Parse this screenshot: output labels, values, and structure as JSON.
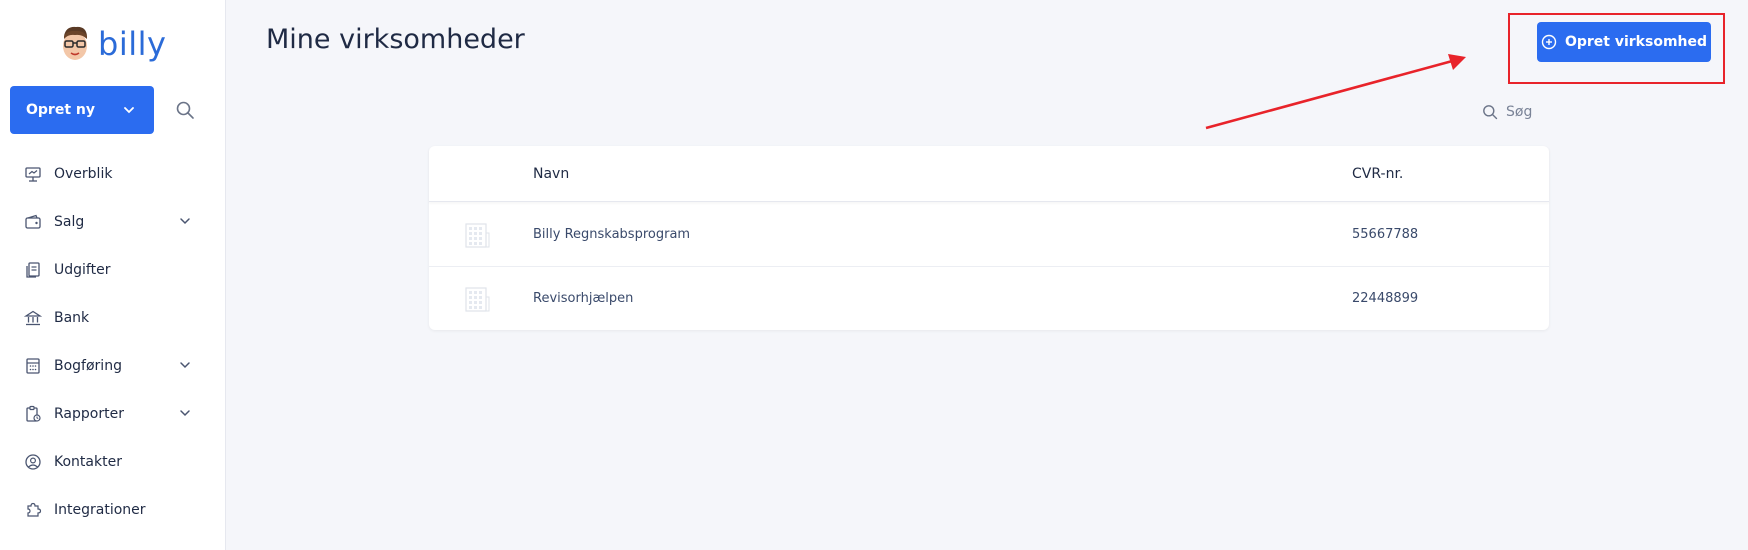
{
  "sidebar": {
    "logo_text": "billy",
    "create_button": "Opret ny",
    "items": [
      {
        "label": "Overblik",
        "icon": "presentation-icon",
        "has_chevron": false
      },
      {
        "label": "Salg",
        "icon": "wallet-icon",
        "has_chevron": true
      },
      {
        "label": "Udgifter",
        "icon": "receipts-icon",
        "has_chevron": false
      },
      {
        "label": "Bank",
        "icon": "bank-icon",
        "has_chevron": false
      },
      {
        "label": "Bogføring",
        "icon": "calculator-icon",
        "has_chevron": true
      },
      {
        "label": "Rapporter",
        "icon": "report-icon",
        "has_chevron": true
      },
      {
        "label": "Kontakter",
        "icon": "user-circle-icon",
        "has_chevron": false
      },
      {
        "label": "Integrationer",
        "icon": "puzzle-icon",
        "has_chevron": false
      }
    ]
  },
  "main": {
    "title": "Mine virksomheder",
    "create_company_button": "Opret virksomhed",
    "search_placeholder": "Søg",
    "table": {
      "headers": {
        "name": "Navn",
        "cvr": "CVR-nr."
      },
      "rows": [
        {
          "name": "Billy Regnskabsprogram",
          "cvr": "55667788"
        },
        {
          "name": "Revisorhjælpen",
          "cvr": "22448899"
        }
      ]
    }
  },
  "colors": {
    "primary": "#2b6cf0",
    "highlight": "#e8232a",
    "background": "#f5f6fa"
  }
}
